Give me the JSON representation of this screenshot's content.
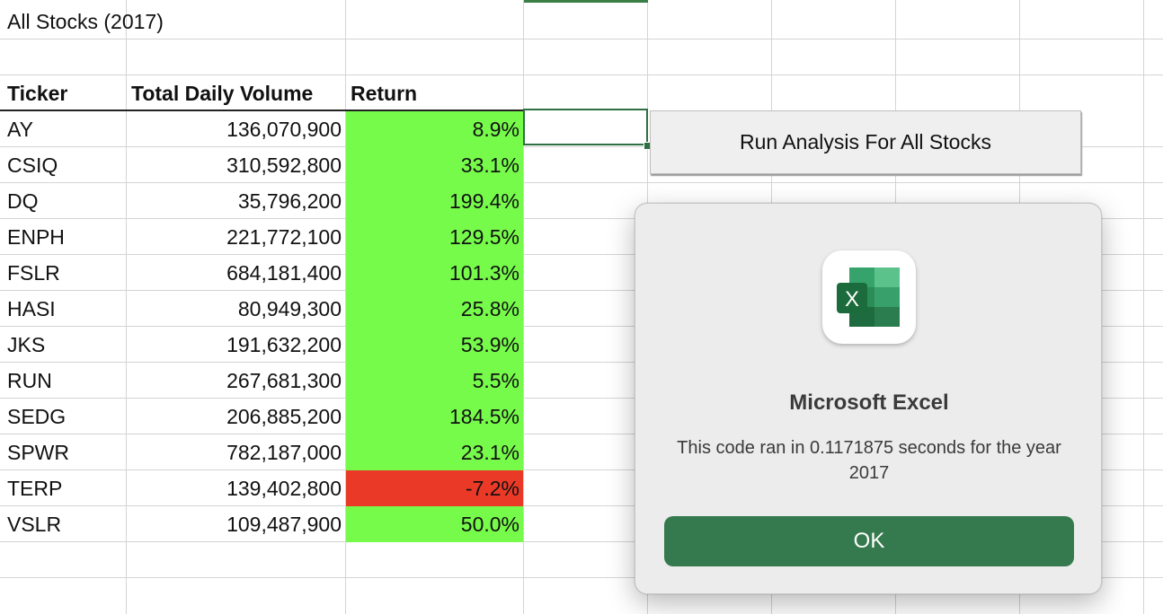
{
  "sheet": {
    "title": "All Stocks (2017)",
    "headers": {
      "ticker": "Ticker",
      "volume": "Total Daily Volume",
      "return": "Return"
    },
    "rows": [
      {
        "ticker": "AY",
        "volume": "136,070,900",
        "return": "8.9%",
        "positive": true
      },
      {
        "ticker": "CSIQ",
        "volume": "310,592,800",
        "return": "33.1%",
        "positive": true
      },
      {
        "ticker": "DQ",
        "volume": "35,796,200",
        "return": "199.4%",
        "positive": true
      },
      {
        "ticker": "ENPH",
        "volume": "221,772,100",
        "return": "129.5%",
        "positive": true
      },
      {
        "ticker": "FSLR",
        "volume": "684,181,400",
        "return": "101.3%",
        "positive": true
      },
      {
        "ticker": "HASI",
        "volume": "80,949,300",
        "return": "25.8%",
        "positive": true
      },
      {
        "ticker": "JKS",
        "volume": "191,632,200",
        "return": "53.9%",
        "positive": true
      },
      {
        "ticker": "RUN",
        "volume": "267,681,300",
        "return": "5.5%",
        "positive": true
      },
      {
        "ticker": "SEDG",
        "volume": "206,885,200",
        "return": "184.5%",
        "positive": true
      },
      {
        "ticker": "SPWR",
        "volume": "782,187,000",
        "return": "23.1%",
        "positive": true
      },
      {
        "ticker": "TERP",
        "volume": "139,402,800",
        "return": "-7.2%",
        "positive": false
      },
      {
        "ticker": "VSLR",
        "volume": "109,487,900",
        "return": "50.0%",
        "positive": true
      }
    ]
  },
  "macro_button": {
    "label": "Run Analysis For All Stocks"
  },
  "dialog": {
    "app_icon": "excel-icon",
    "icon_letter": "X",
    "title": "Microsoft Excel",
    "message": "This code ran in 0.1171875 seconds for the year 2017",
    "ok_label": "OK"
  },
  "colors": {
    "positive_fill": "#77fb4b",
    "negative_fill": "#ea3a27",
    "accent_green": "#357a4e"
  }
}
